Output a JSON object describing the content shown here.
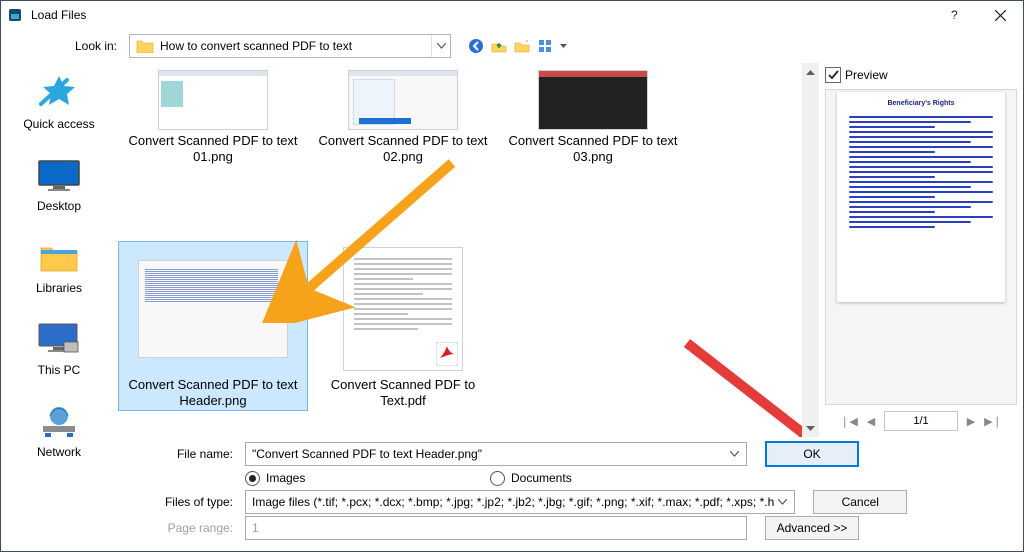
{
  "window": {
    "title": "Load Files"
  },
  "lookin": {
    "label": "Look in:",
    "value": "How to convert scanned PDF to text"
  },
  "toolbar_icons": [
    "back-icon",
    "up-one-level-icon",
    "new-folder-icon",
    "view-menu-icon"
  ],
  "places": [
    {
      "key": "quick-access",
      "label": "Quick access"
    },
    {
      "key": "desktop",
      "label": "Desktop"
    },
    {
      "key": "libraries",
      "label": "Libraries"
    },
    {
      "key": "this-pc",
      "label": "This PC"
    },
    {
      "key": "network",
      "label": "Network"
    }
  ],
  "files_row1": [
    {
      "name": "Convert Scanned PDF to text 01.png",
      "kind": "screenshot-a"
    },
    {
      "name": "Convert Scanned PDF to text 02.png",
      "kind": "screenshot-b"
    },
    {
      "name": "Convert Scanned PDF to text 03.png",
      "kind": "screenshot-dark"
    }
  ],
  "files_row2": [
    {
      "name": "Convert Scanned PDF to text Header.png",
      "kind": "doc",
      "selected": true
    },
    {
      "name": "Convert Scanned PDF to Text.pdf",
      "kind": "pdf"
    }
  ],
  "preview": {
    "checkbox_label": "Preview",
    "checked": true,
    "doc_title": "Beneficiary's Rights",
    "page_indicator": "1/1"
  },
  "filename": {
    "label": "File name:",
    "value": "\"Convert Scanned PDF to text Header.png\""
  },
  "radio": {
    "images": "Images",
    "documents": "Documents",
    "selected": "images"
  },
  "filetype": {
    "label": "Files of type:",
    "value": "Image files (*.tif; *.pcx; *.dcx; *.bmp; *.jpg; *.jp2; *.jb2; *.jbg; *.gif; *.png; *.xif; *.max; *.pdf; *.xps; *.h"
  },
  "page_range": {
    "label": "Page range:",
    "value": "1"
  },
  "buttons": {
    "ok": "OK",
    "cancel": "Cancel",
    "advanced": "Advanced >>"
  }
}
